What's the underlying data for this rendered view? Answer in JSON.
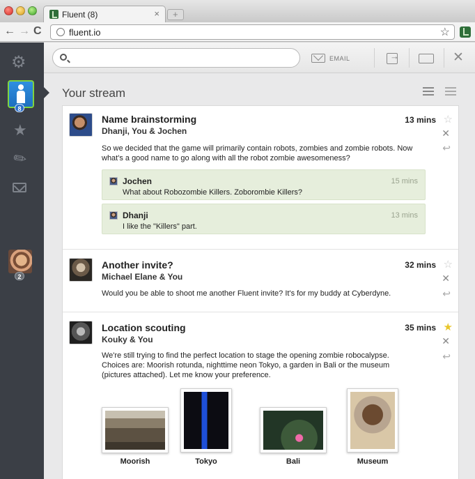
{
  "browser": {
    "tab_title": "Fluent (8)",
    "url": "fluent.io"
  },
  "sidebar": {
    "user_badge": "8",
    "contact_badge": "2"
  },
  "searchbar": {
    "email_label": "EMAIL"
  },
  "stream": {
    "title": "Your stream",
    "messages": [
      {
        "title": "Name brainstorming",
        "people": "Dhanji, You & Jochen",
        "time": "13 mins",
        "starred": false,
        "body": "So we decided that the game will primarily contain robots, zombies and zombie robots. Now what's a good name to go along with all the robot zombie awesomeness?",
        "replies": [
          {
            "name": "Jochen",
            "time": "15 mins",
            "text": "What about Robozombie Killers. Zoborombie Killers?"
          },
          {
            "name": "Dhanji",
            "time": "13 mins",
            "text": "I like the \"Killers\" part."
          }
        ]
      },
      {
        "title": "Another invite?",
        "people": "Michael Elane & You",
        "time": "32 mins",
        "starred": false,
        "body": "Would you be able to shoot me another Fluent invite? It's for my buddy at Cyberdyne."
      },
      {
        "title": "Location scouting",
        "people": "Kouky & You",
        "time": "35 mins",
        "starred": true,
        "body": "We're still trying to find the perfect location to stage the opening zombie robocalypse. Choices are: Moorish rotunda, nighttime neon Tokyo, a garden in Bali or the museum (pictures attached). Let me know your preference.",
        "attachments": [
          "Moorish",
          "Tokyo",
          "Bali",
          "Museum"
        ]
      }
    ]
  }
}
